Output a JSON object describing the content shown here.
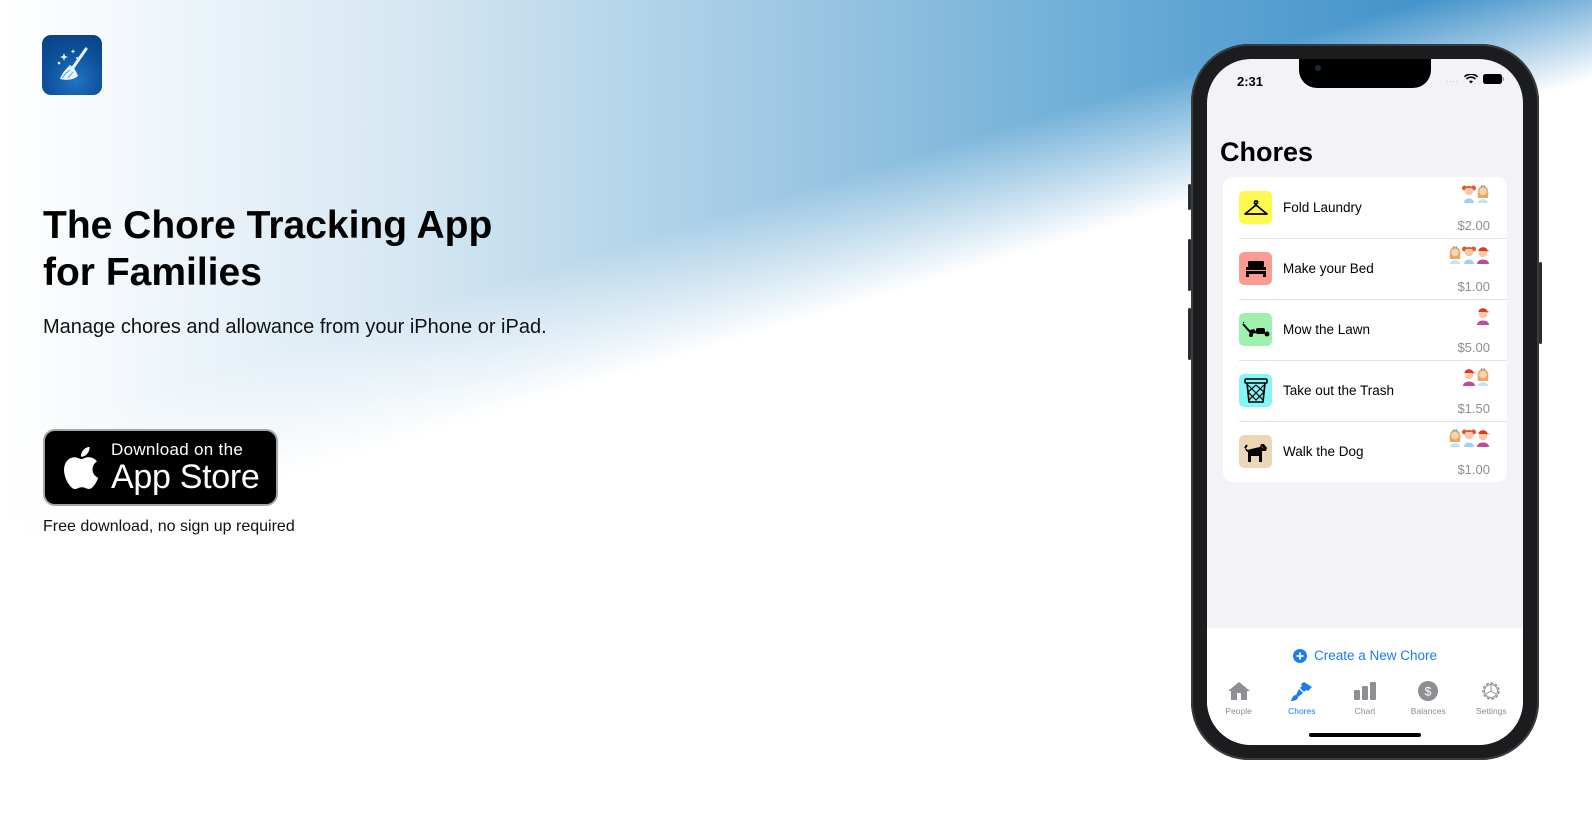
{
  "site": {
    "logo_icon": "broom-sparkles-icon",
    "headline_line1": "The Chore Tracking App",
    "headline_line2": "for Families",
    "subhead": "Manage chores and allowance from your iPhone or iPad.",
    "badge": {
      "icon": "apple-logo-icon",
      "small_text": "Download on the",
      "large_text": "App Store"
    },
    "free_note": "Free download, no sign up required"
  },
  "phone": {
    "status": {
      "time": "2:31",
      "signal": "....",
      "wifi_icon": "wifi-icon",
      "battery_icon": "battery-icon"
    },
    "title": "Chores",
    "accent_color": "#1a7cf0",
    "chores": [
      {
        "name": "Fold Laundry",
        "amount": "$2.00",
        "icon": "hanger-icon",
        "color": "#fdf94f",
        "assignees": [
          "girl-redhair",
          "girl-blonde"
        ]
      },
      {
        "name": "Make your Bed",
        "amount": "$1.00",
        "icon": "bed-icon",
        "color": "#fb9b93",
        "assignees": [
          "girl-blonde",
          "girl-redhair",
          "boy-redcap"
        ]
      },
      {
        "name": "Mow the Lawn",
        "amount": "$5.00",
        "icon": "lawnmower-icon",
        "color": "#9ef0ad",
        "assignees": [
          "boy-redcap"
        ]
      },
      {
        "name": "Take out the Trash",
        "amount": "$1.50",
        "icon": "trash-basket-icon",
        "color": "#86f5f4",
        "assignees": [
          "boy-redcap",
          "girl-blonde"
        ]
      },
      {
        "name": "Walk the Dog",
        "amount": "$1.00",
        "icon": "dog-icon",
        "color": "#ebd6b8",
        "assignees": [
          "girl-blonde",
          "girl-redhair",
          "boy-redcap"
        ]
      }
    ],
    "create_button": "Create a New Chore",
    "tabs": [
      {
        "label": "People",
        "icon": "house-icon",
        "active": false
      },
      {
        "label": "Chores",
        "icon": "paintbrush-icon",
        "active": true
      },
      {
        "label": "Chart",
        "icon": "bar-chart-icon",
        "active": false
      },
      {
        "label": "Balances",
        "icon": "dollar-circle-icon",
        "active": false
      },
      {
        "label": "Settings",
        "icon": "gear-icon",
        "active": false
      }
    ]
  }
}
